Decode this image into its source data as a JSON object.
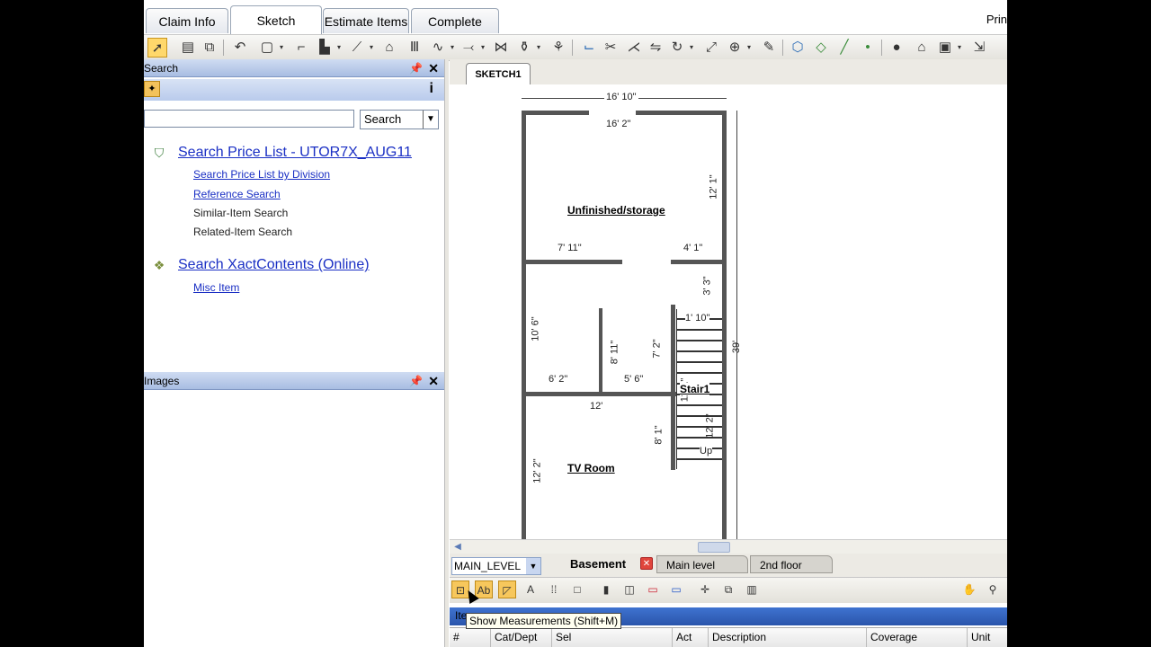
{
  "tabs": [
    "Claim Info",
    "Sketch",
    "Estimate Items",
    "Complete"
  ],
  "active_tab": "Sketch",
  "header_right": "Prin",
  "search_panel": {
    "title": "Search",
    "combo_value": "Search",
    "price_list_link": "Search Price List - UTOR7X_AUG11",
    "sub_links": [
      "Search Price List by Division",
      "Reference Search"
    ],
    "sub_texts": [
      "Similar-Item Search",
      "Related-Item Search"
    ],
    "xact_link": "Search XactContents (Online)",
    "misc_link": "Misc Item",
    "info_label": "i"
  },
  "images_panel": {
    "title": "Images"
  },
  "sketch": {
    "tab_label": "SKETCH1",
    "rooms": [
      "Unfinished/storage",
      "Stair1",
      "TV Room"
    ],
    "dims": [
      "16' 10\"",
      "16' 2\"",
      "12' 1\"",
      "7' 11\"",
      "4' 1\"",
      "3' 3\"",
      "1' 10\"",
      "10' 6\"",
      "8' 11\"",
      "7' 2\"",
      "6' 2\"",
      "5' 6\"",
      "12'",
      "8' 1\"",
      "12' 2\"",
      "11' 1\"",
      "12' 2\"",
      "39'",
      "Up"
    ]
  },
  "levels": {
    "select": "MAIN_LEVEL",
    "tabs": [
      "Basement",
      "Main level",
      "2nd floor"
    ],
    "active": "Basement"
  },
  "tooltip": "Show Measurements (Shift+M)",
  "items_bar": "Ite",
  "grid_columns": [
    "#",
    "Cat/Dept",
    "Sel",
    "Act",
    "Description",
    "Coverage",
    "Unit"
  ]
}
